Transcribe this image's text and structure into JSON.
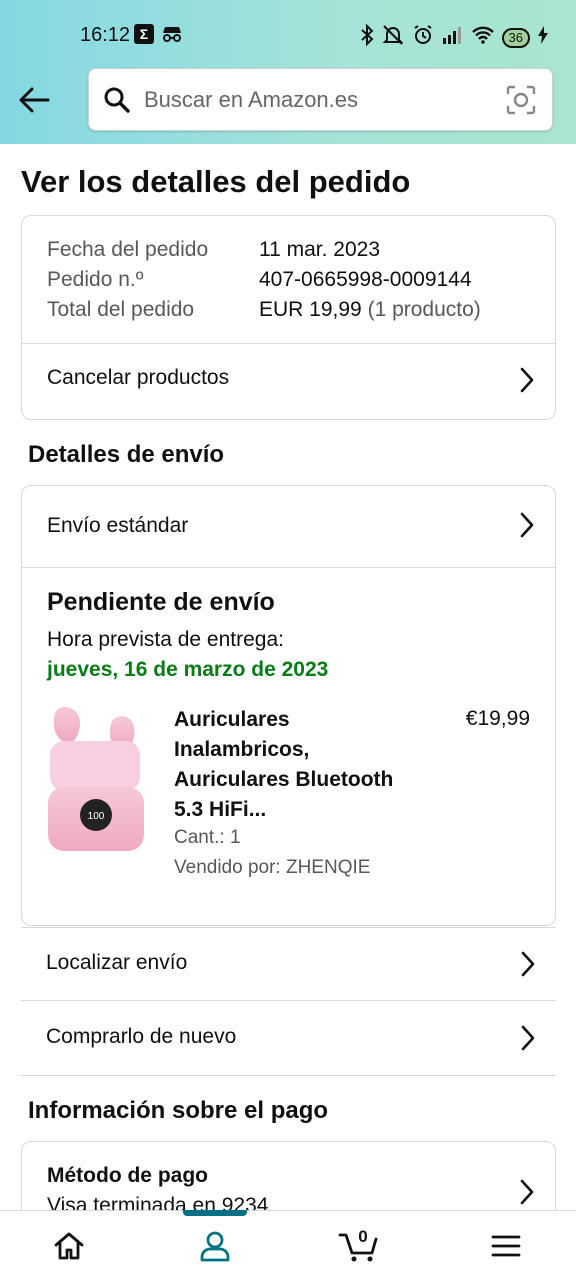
{
  "status_bar": {
    "time": "16:12",
    "battery": "36",
    "icons": [
      "notification-icon",
      "incognito-icon",
      "bluetooth-icon",
      "mute-icon",
      "alarm-icon",
      "signal-icon",
      "wifi-icon",
      "battery-icon",
      "charging-icon"
    ]
  },
  "search": {
    "placeholder": "Buscar en Amazon.es"
  },
  "page": {
    "title": "Ver los detalles del pedido"
  },
  "order": {
    "date_label": "Fecha del pedido",
    "date_value": "11 mar. 2023",
    "number_label": "Pedido n.º",
    "number_value": "407-0665998-0009144",
    "total_label": "Total del pedido",
    "total_value": "EUR 19,99",
    "total_items": "(1 producto)",
    "cancel_label": "Cancelar productos"
  },
  "shipping": {
    "section_title": "Detalles de envío",
    "method": "Envío estándar",
    "status": "Pendiente de envío",
    "eta_label": "Hora prevista de entrega:",
    "eta_date": "jueves, 16 de marzo de 2023",
    "product": {
      "name": "Auriculares Inalambricos, Auriculares Bluetooth 5.3 HiFi...",
      "price": "€19,99",
      "qty": "Cant.: 1",
      "seller": "Vendido por: ZHENQIE"
    },
    "track_label": "Localizar envío",
    "buy_again_label": "Comprarlo de nuevo"
  },
  "payment": {
    "section_title": "Información sobre el pago",
    "method_title": "Método de pago",
    "method_detail": "Visa terminada en 9234"
  },
  "nav": {
    "cart_count": "0",
    "active_tab": "account"
  },
  "colors": {
    "delivery_green": "#067d17",
    "accent_teal": "#007185",
    "header_gradient_start": "#84d8e3",
    "header_gradient_end": "#a9e5cf"
  }
}
